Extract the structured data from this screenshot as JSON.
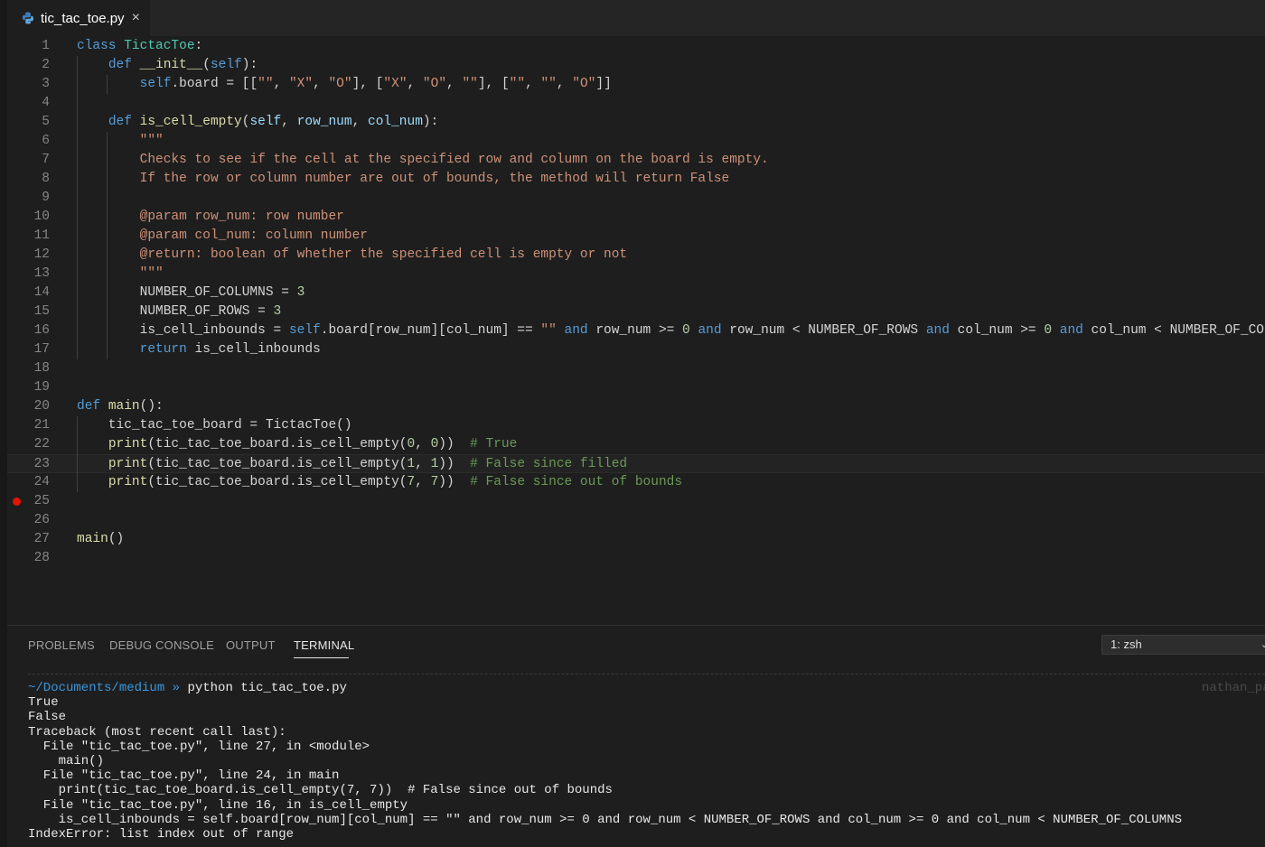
{
  "tab": {
    "filename": "tic_tac_toe.py",
    "close_glyph": "×",
    "icon": "python-icon"
  },
  "editor": {
    "current_line": 23,
    "breakpoint_line": 25,
    "lines": [
      {
        "n": "1",
        "t": [
          [
            "kw",
            "class "
          ],
          [
            "cls",
            "TictacToe"
          ],
          [
            "",
            ":"
          ]
        ]
      },
      {
        "n": "2",
        "t": [
          [
            "",
            "    "
          ],
          [
            "kw",
            "def "
          ],
          [
            "fn",
            "__init__"
          ],
          [
            "",
            "("
          ],
          [
            "slf",
            "self"
          ],
          [
            "",
            "):"
          ]
        ]
      },
      {
        "n": "3",
        "t": [
          [
            "",
            "        "
          ],
          [
            "slf",
            "self"
          ],
          [
            "",
            ".board = [["
          ],
          [
            "str",
            "\"\""
          ],
          [
            "",
            ", "
          ],
          [
            "str",
            "\"X\""
          ],
          [
            "",
            ", "
          ],
          [
            "str",
            "\"O\""
          ],
          [
            "",
            "], ["
          ],
          [
            "str",
            "\"X\""
          ],
          [
            "",
            ", "
          ],
          [
            "str",
            "\"O\""
          ],
          [
            "",
            ", "
          ],
          [
            "str",
            "\"\""
          ],
          [
            "",
            "], ["
          ],
          [
            "str",
            "\"\""
          ],
          [
            "",
            ", "
          ],
          [
            "str",
            "\"\""
          ],
          [
            "",
            ", "
          ],
          [
            "str",
            "\"O\""
          ],
          [
            "",
            "]]"
          ]
        ]
      },
      {
        "n": "4",
        "t": []
      },
      {
        "n": "5",
        "t": [
          [
            "",
            "    "
          ],
          [
            "kw",
            "def "
          ],
          [
            "fn",
            "is_cell_empty"
          ],
          [
            "",
            "("
          ],
          [
            "prm",
            "self"
          ],
          [
            "",
            ", "
          ],
          [
            "prm",
            "row_num"
          ],
          [
            "",
            ", "
          ],
          [
            "prm",
            "col_num"
          ],
          [
            "",
            "):"
          ]
        ]
      },
      {
        "n": "6",
        "t": [
          [
            "",
            "        "
          ],
          [
            "str",
            "\"\"\""
          ]
        ]
      },
      {
        "n": "7",
        "t": [
          [
            "",
            "        "
          ],
          [
            "str",
            "Checks to see if the cell at the specified row and column on the board is empty."
          ]
        ]
      },
      {
        "n": "8",
        "t": [
          [
            "",
            "        "
          ],
          [
            "str",
            "If the row or column number are out of bounds, the method will return False"
          ]
        ]
      },
      {
        "n": "9",
        "t": []
      },
      {
        "n": "10",
        "t": [
          [
            "",
            "        "
          ],
          [
            "str",
            "@param row_num: row number"
          ]
        ]
      },
      {
        "n": "11",
        "t": [
          [
            "",
            "        "
          ],
          [
            "str",
            "@param col_num: column number"
          ]
        ]
      },
      {
        "n": "12",
        "t": [
          [
            "",
            "        "
          ],
          [
            "str",
            "@return: boolean of whether the specified cell is empty or not"
          ]
        ]
      },
      {
        "n": "13",
        "t": [
          [
            "",
            "        "
          ],
          [
            "str",
            "\"\"\""
          ]
        ]
      },
      {
        "n": "14",
        "t": [
          [
            "",
            "        NUMBER_OF_COLUMNS = "
          ],
          [
            "num",
            "3"
          ]
        ]
      },
      {
        "n": "15",
        "t": [
          [
            "",
            "        NUMBER_OF_ROWS = "
          ],
          [
            "num",
            "3"
          ]
        ]
      },
      {
        "n": "16",
        "t": [
          [
            "",
            "        is_cell_inbounds = "
          ],
          [
            "slf",
            "self"
          ],
          [
            "",
            ".board[row_num][col_num] == "
          ],
          [
            "str",
            "\"\""
          ],
          [
            "kw",
            " and"
          ],
          [
            "",
            " row_num >= "
          ],
          [
            "num",
            "0"
          ],
          [
            "kw",
            " and"
          ],
          [
            "",
            " row_num < NUMBER_OF_ROWS "
          ],
          [
            "kw",
            "and"
          ],
          [
            "",
            " col_num >= "
          ],
          [
            "num",
            "0"
          ],
          [
            "kw",
            " and"
          ],
          [
            "",
            " col_num < NUMBER_OF_COLUMNS"
          ]
        ]
      },
      {
        "n": "17",
        "t": [
          [
            "",
            "        "
          ],
          [
            "kw",
            "return"
          ],
          [
            "",
            " is_cell_inbounds"
          ]
        ]
      },
      {
        "n": "18",
        "t": []
      },
      {
        "n": "19",
        "t": []
      },
      {
        "n": "20",
        "t": [
          [
            "kw",
            "def "
          ],
          [
            "fn",
            "main"
          ],
          [
            "",
            "():"
          ]
        ]
      },
      {
        "n": "21",
        "t": [
          [
            "",
            "    tic_tac_toe_board = TictacToe()"
          ]
        ]
      },
      {
        "n": "22",
        "t": [
          [
            "",
            "    "
          ],
          [
            "fn",
            "print"
          ],
          [
            "",
            "(tic_tac_toe_board.is_cell_empty("
          ],
          [
            "num",
            "0"
          ],
          [
            "",
            ", "
          ],
          [
            "num",
            "0"
          ],
          [
            "",
            "))  "
          ],
          [
            "cmt",
            "# True"
          ]
        ]
      },
      {
        "n": "23",
        "t": [
          [
            "",
            "    "
          ],
          [
            "fn",
            "print"
          ],
          [
            "",
            "(tic_tac_toe_board.is_cell_empty("
          ],
          [
            "num",
            "1"
          ],
          [
            "",
            ", "
          ],
          [
            "num",
            "1"
          ],
          [
            "",
            "))  "
          ],
          [
            "cmt",
            "# False since filled"
          ]
        ]
      },
      {
        "n": "24",
        "t": [
          [
            "",
            "    "
          ],
          [
            "fn",
            "print"
          ],
          [
            "",
            "(tic_tac_toe_board.is_cell_empty("
          ],
          [
            "num",
            "7"
          ],
          [
            "",
            ", "
          ],
          [
            "num",
            "7"
          ],
          [
            "",
            "))  "
          ],
          [
            "cmt",
            "# False since out of bounds"
          ]
        ]
      },
      {
        "n": "25",
        "t": []
      },
      {
        "n": "26",
        "t": []
      },
      {
        "n": "27",
        "t": [
          [
            "fn",
            "main"
          ],
          [
            "",
            "()"
          ]
        ]
      },
      {
        "n": "28",
        "t": []
      }
    ]
  },
  "panel": {
    "tabs": [
      "PROBLEMS",
      "DEBUG CONSOLE",
      "OUTPUT",
      "TERMINAL"
    ],
    "active_tab": "TERMINAL",
    "shell_select": "1: zsh"
  },
  "terminal": {
    "prompt_path": "~/Documents/medium",
    "prompt_arrow": " » ",
    "command": "python tic_tac_toe.py",
    "right_prompt": "nathan_pa",
    "output": [
      "True",
      "False",
      "Traceback (most recent call last):",
      "  File \"tic_tac_toe.py\", line 27, in <module>",
      "    main()",
      "  File \"tic_tac_toe.py\", line 24, in main",
      "    print(tic_tac_toe_board.is_cell_empty(7, 7))  # False since out of bounds",
      "  File \"tic_tac_toe.py\", line 16, in is_cell_empty",
      "    is_cell_inbounds = self.board[row_num][col_num] == \"\" and row_num >= 0 and row_num < NUMBER_OF_ROWS and col_num >= 0 and col_num < NUMBER_OF_COLUMNS",
      "IndexError: list index out of range"
    ]
  },
  "colors": {
    "background": "#1e1e1e",
    "keyword": "#569cd6",
    "class_name": "#4ec9b0",
    "function": "#dcdcaa",
    "string": "#ce9178",
    "number": "#b5cea8",
    "comment": "#6a9955",
    "breakpoint": "#e51400"
  }
}
